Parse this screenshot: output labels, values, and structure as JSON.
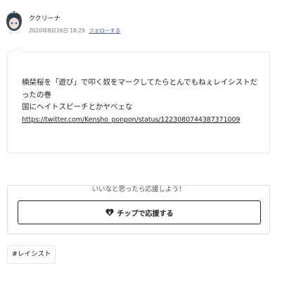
{
  "author": {
    "name": "ククリーナ",
    "avatar_icon": "anime-avatar-icon",
    "date": "2020年8月16日 18:29",
    "follow_label": "フォローする"
  },
  "post": {
    "lines": [
      "楠栞桜を「遊び」で叩く奴をマークしてたらとんでもねぇレイシストだったの巻",
      "国にヘイトスピーチとかヤベェな"
    ],
    "link": "https://twitter.com/Kensho_ponpon/status/1223080744387371009"
  },
  "tip": {
    "prompt": "いいなと思ったら応援しよう！",
    "button_label": "チップで応援する",
    "button_icon": "yen-heart-icon"
  },
  "tags": [
    "#レイシスト"
  ],
  "colors": {
    "accent_link": "#3a5fb0",
    "border": "#e9e9e9",
    "text": "#222222"
  }
}
